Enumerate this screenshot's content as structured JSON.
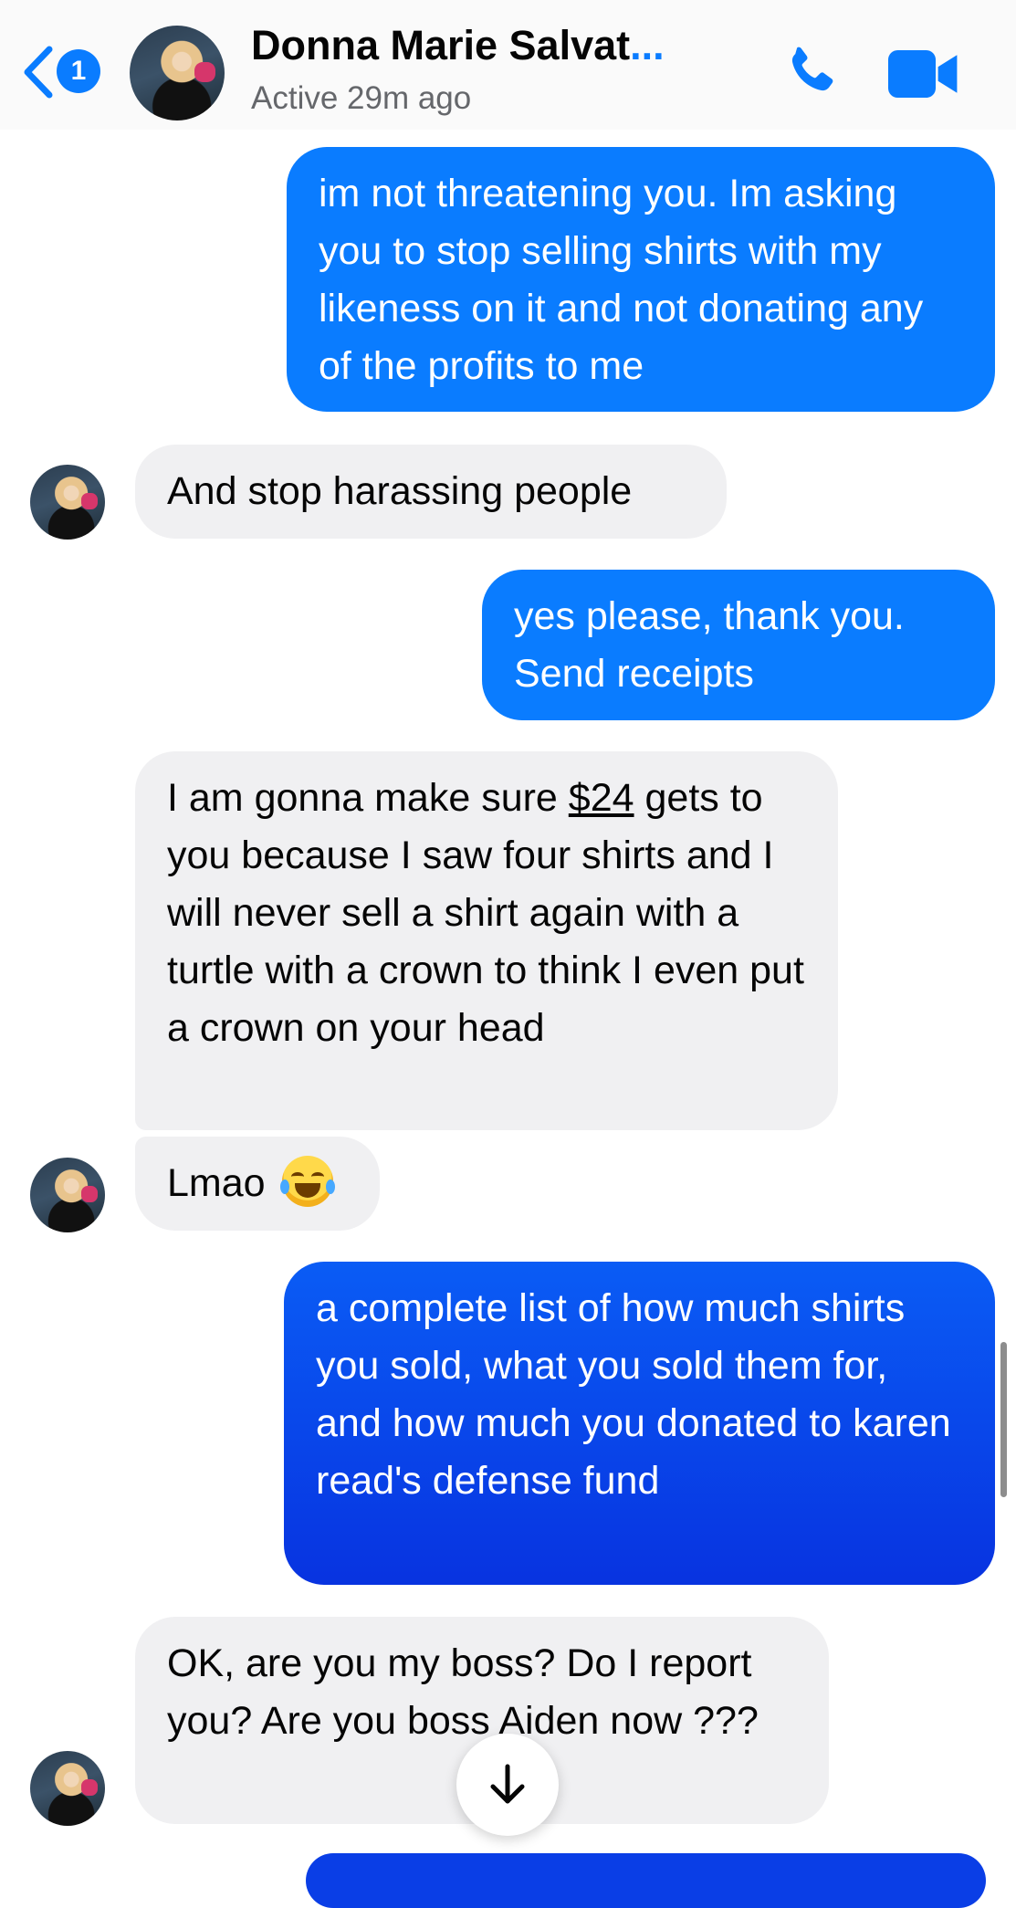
{
  "header": {
    "back_badge": "1",
    "contact_name": "Donna Marie Salvat",
    "name_ellipsis": "...",
    "status": "Active 29m ago"
  },
  "messages": [
    {
      "dir": "out",
      "text": "im not threatening you. Im asking you to stop selling shirts with my likeness on it and not donating any of the profits to me"
    },
    {
      "dir": "in",
      "text": "And stop harassing people"
    },
    {
      "dir": "out",
      "text": "yes please, thank you. Send receipts"
    },
    {
      "dir": "in",
      "text_before": "I am gonna make sure ",
      "link": "$24",
      "text_after": " gets to you because I saw four shirts and I will never sell a shirt again with a turtle with a crown to think I even put a crown on your head"
    },
    {
      "dir": "in",
      "text": "Lmao",
      "emoji": "face-with-tears-of-joy"
    },
    {
      "dir": "out",
      "text": "a complete list of how much shirts you sold, what you sold them for, and how much you donated to karen read's defense fund"
    },
    {
      "dir": "in",
      "text": "OK, are you my boss? Do I report you? Are you boss Aiden now ???"
    }
  ],
  "colors": {
    "outgoing": "#0a7cff",
    "incoming": "#f0f0f2",
    "accent": "#0a7cff"
  },
  "icons": [
    "back-chevron-icon",
    "phone-icon",
    "video-camera-icon",
    "arrow-down-icon"
  ]
}
